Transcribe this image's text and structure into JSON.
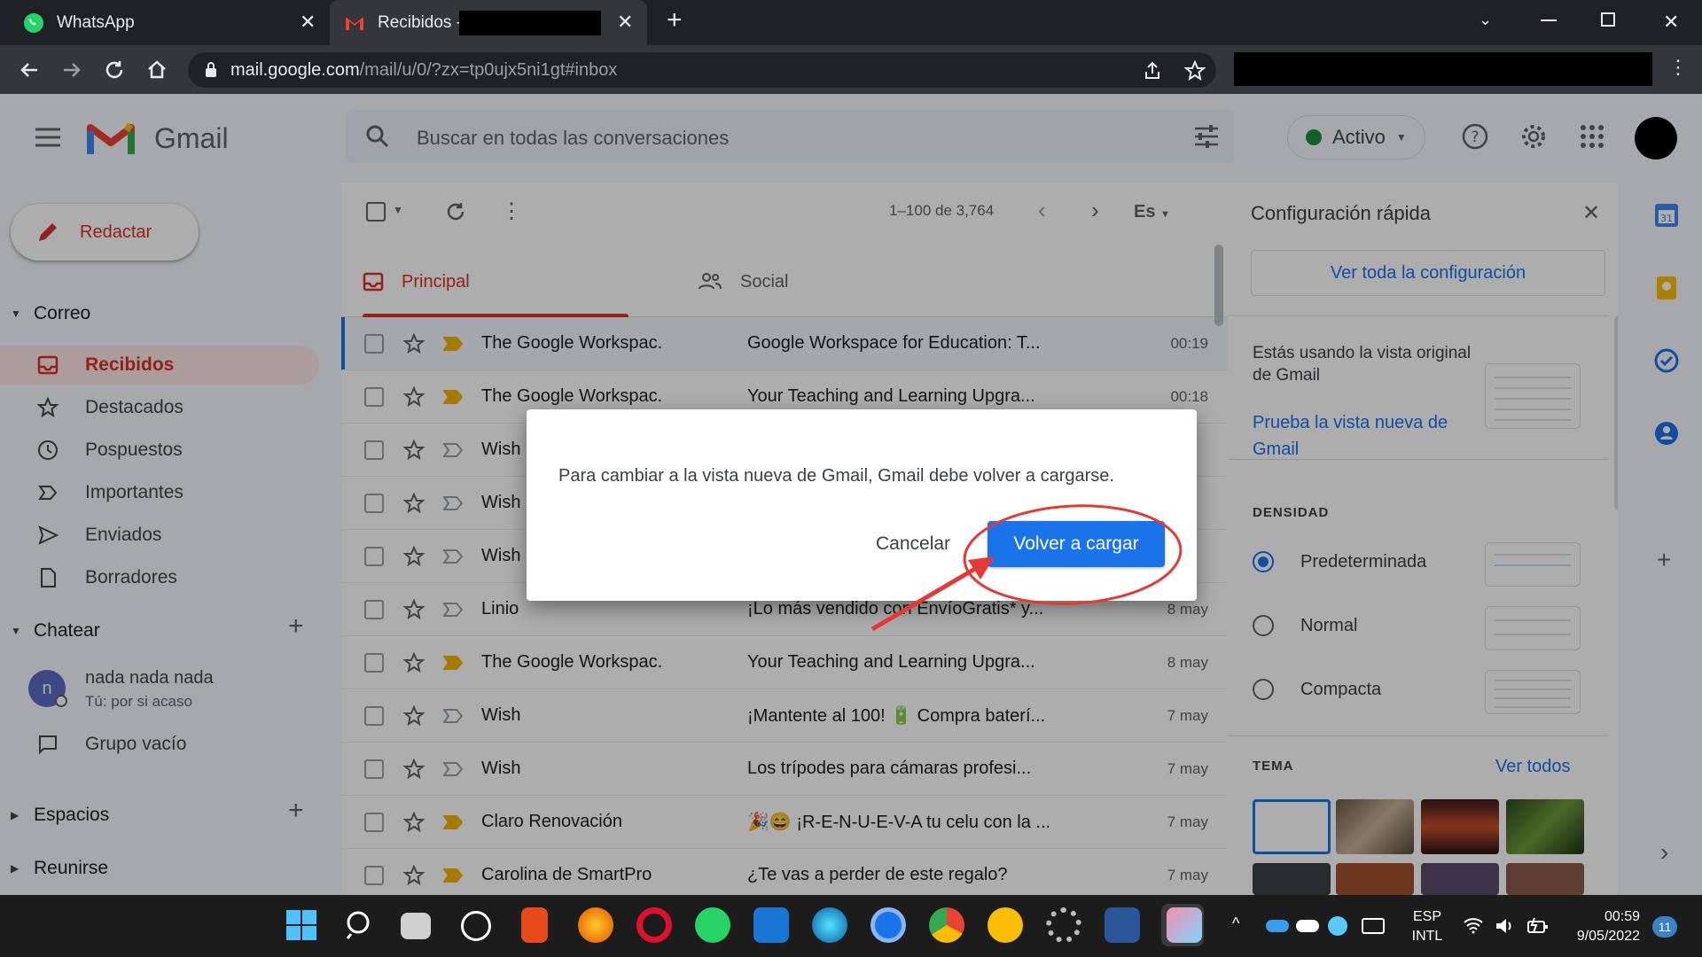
{
  "browser": {
    "tabs": [
      {
        "title": "WhatsApp"
      },
      {
        "title": "Recibidos -"
      }
    ],
    "url_host": "mail.google.com",
    "url_path": "/mail/u/0/?zx=tp0ujx5ni1gt#inbox"
  },
  "gmail": {
    "logo_text": "Gmail",
    "search_placeholder": "Buscar en todas las conversaciones",
    "status": "Activo"
  },
  "sidebar": {
    "compose_label": "Redactar",
    "mail_section": "Correo",
    "items": [
      {
        "label": "Recibidos",
        "icon": "inbox-icon",
        "selected": true
      },
      {
        "label": "Destacados",
        "icon": "star-icon"
      },
      {
        "label": "Pospuestos",
        "icon": "clock-icon"
      },
      {
        "label": "Importantes",
        "icon": "important-icon"
      },
      {
        "label": "Enviados",
        "icon": "send-icon"
      },
      {
        "label": "Borradores",
        "icon": "draft-icon"
      }
    ],
    "chat_section": "Chatear",
    "chat_user_name": "nada nada nada",
    "chat_user_status": "Tú: por si acaso",
    "chat_avatar_letter": "n",
    "chat_group": "Grupo vacío",
    "spaces_section": "Espacios",
    "meet_section": "Reunirse"
  },
  "inbox": {
    "pager": "1–100 de 3,764",
    "lang_button": "Es",
    "tab_primary": "Principal",
    "tab_social": "Social",
    "rows": [
      {
        "sender": "The Google Workspac.",
        "subject": "Google Workspace for Education: T...",
        "date": "00:19",
        "important": true
      },
      {
        "sender": "The Google Workspac.",
        "subject": "Your Teaching and Learning Upgra...",
        "date": "00:18",
        "important": true
      },
      {
        "sender": "Wish",
        "subject": "",
        "date": "",
        "important": false
      },
      {
        "sender": "Wish",
        "subject": "",
        "date": "",
        "important": false
      },
      {
        "sender": "Wish",
        "subject": "",
        "date": "",
        "important": false
      },
      {
        "sender": "Linio",
        "subject": "¡Lo más vendido con EnvíoGratis* y...",
        "date": "8 may",
        "important": false
      },
      {
        "sender": "The Google Workspac.",
        "subject": "Your Teaching and Learning Upgra...",
        "date": "8 may",
        "important": true
      },
      {
        "sender": "Wish",
        "subject": "¡Mantente al 100! 🔋 Compra baterí...",
        "date": "7 may",
        "important": false
      },
      {
        "sender": "Wish",
        "subject": "Los trípodes para cámaras profesi...",
        "date": "7 may",
        "important": false
      },
      {
        "sender": "Claro Renovación",
        "subject": "🎉😄 ¡R-E-N-U-E-V-A tu celu con la ...",
        "date": "7 may",
        "important": true
      },
      {
        "sender": "Carolina de SmartPro",
        "subject": "¿Te vas a perder de este regalo?",
        "date": "7 may",
        "important": true
      }
    ]
  },
  "quick_settings": {
    "title": "Configuración rápida",
    "see_all": "Ver toda la configuración",
    "view_text": "Estás usando la vista original de Gmail",
    "try_new": "Prueba la vista nueva de Gmail",
    "density_title": "DENSIDAD",
    "density_options": [
      "Predeterminada",
      "Normal",
      "Compacta"
    ],
    "density_selected": "Predeterminada",
    "theme_title": "TEMA",
    "theme_see_all": "Ver todos"
  },
  "dialog": {
    "message": "Para cambiar a la vista nueva de Gmail, Gmail debe volver a cargarse.",
    "cancel": "Cancelar",
    "reload": "Volver a cargar"
  },
  "taskbar": {
    "lang_line1": "ESP",
    "lang_line2": "INTL",
    "time": "00:59",
    "date": "9/05/2022",
    "notifications": "11"
  },
  "colors": {
    "accent_red": "#d93025",
    "primary_blue": "#1a73e8",
    "annotation_red": "#e53935"
  }
}
